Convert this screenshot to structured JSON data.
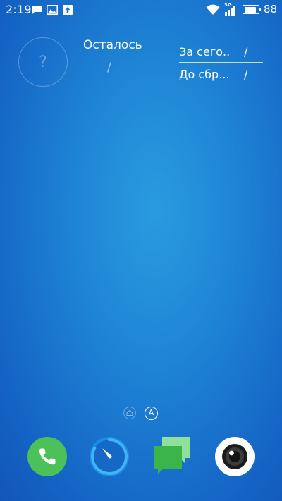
{
  "status_bar": {
    "time": "2:19",
    "network_label": "3G",
    "battery_level": "88",
    "notification_icons": [
      "chat-icon",
      "image-icon",
      "upload-icon"
    ],
    "system_icons": [
      "wifi-icon",
      "signal-icon",
      "battery-icon"
    ]
  },
  "widget": {
    "circle_mark": "?",
    "remaining_label": "Осталось",
    "remaining_value": "/",
    "today_label": "За сего..",
    "today_value": "/",
    "reset_label": "До сбр...",
    "reset_value": "/"
  },
  "page_indicator": {
    "home_icon": "home-icon",
    "active_label": "A"
  },
  "dock": {
    "apps": [
      {
        "icon": "phone-icon",
        "color": "#4cc15a"
      },
      {
        "icon": "speedometer-icon",
        "color": "#1a8ee6"
      },
      {
        "icon": "messages-icon",
        "color": "#3bb54a"
      },
      {
        "icon": "camera-icon",
        "color": "#ffffff"
      }
    ]
  }
}
